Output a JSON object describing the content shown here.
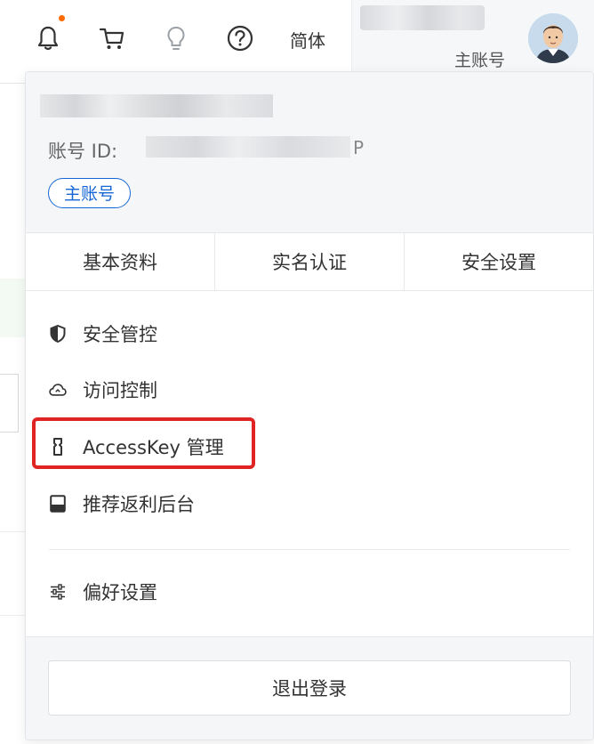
{
  "topbar": {
    "icons": [
      "bell-icon",
      "cart-icon",
      "bulb-icon",
      "help-icon"
    ],
    "language": "简体",
    "account_type": "主账号",
    "notification_dot_color": "#ff6a00"
  },
  "dropdown": {
    "account_id_label": "账号 ID:",
    "account_id_tail": "P",
    "badge": "主账号",
    "tabs": [
      {
        "label": "基本资料"
      },
      {
        "label": "实名认证"
      },
      {
        "label": "安全设置"
      }
    ],
    "menu": [
      {
        "icon": "shield-icon",
        "label": "安全管控"
      },
      {
        "icon": "cloud-icon",
        "label": "访问控制"
      },
      {
        "icon": "key-icon",
        "label": "AccessKey 管理"
      },
      {
        "icon": "card-icon",
        "label": "推荐返利后台"
      }
    ],
    "preferences": {
      "icon": "sliders-icon",
      "label": "偏好设置"
    },
    "logout": "退出登录",
    "highlight_color": "#e02424",
    "accent_color": "#1766d6"
  }
}
